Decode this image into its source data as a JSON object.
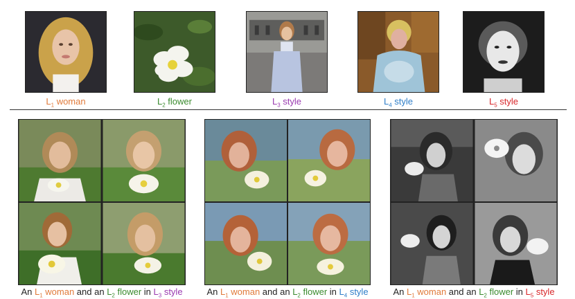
{
  "references": [
    {
      "id": "L1",
      "word": "woman",
      "color": "#e07a3a"
    },
    {
      "id": "L2",
      "word": "flower",
      "color": "#3a8b2e"
    },
    {
      "id": "L3",
      "word": "style",
      "color": "#9a3ab0"
    },
    {
      "id": "L4",
      "word": "style",
      "color": "#2e7ec8"
    },
    {
      "id": "L5",
      "word": "style",
      "color": "#d8262a"
    }
  ],
  "captions": [
    {
      "pre": "An ",
      "woman_id": "L",
      "woman_sub": "1",
      "woman": " woman",
      "mid": " and an ",
      "flower_id": "L",
      "flower_sub": "2",
      "flower": " flower",
      "in": " in ",
      "style_id": "L",
      "style_sub": "3",
      "style": " style",
      "style_color": "#9a3ab0"
    },
    {
      "pre": "An ",
      "woman_id": "L",
      "woman_sub": "1",
      "woman": " woman",
      "mid": " and an ",
      "flower_id": "L",
      "flower_sub": "2",
      "flower": " flower",
      "in": " in ",
      "style_id": "L",
      "style_sub": "4",
      "style": " style",
      "style_color": "#2e7ec8"
    },
    {
      "pre": "An ",
      "woman_id": "L",
      "woman_sub": "1",
      "woman": " woman",
      "mid": " and an ",
      "flower_id": "L",
      "flower_sub": "2",
      "flower": " flower",
      "in": " in ",
      "style_id": "L",
      "style_sub": "5",
      "style": " style",
      "style_color": "#d8262a"
    }
  ],
  "labels": {
    "l1": {
      "letter": "L",
      "sub": "1",
      "word": " woman"
    },
    "l2": {
      "letter": "L",
      "sub": "2",
      "word": " flower"
    },
    "l3": {
      "letter": "L",
      "sub": "3",
      "word": " style"
    },
    "l4": {
      "letter": "L",
      "sub": "4",
      "word": " style"
    },
    "l5": {
      "letter": "L",
      "sub": "5",
      "word": " style"
    }
  }
}
